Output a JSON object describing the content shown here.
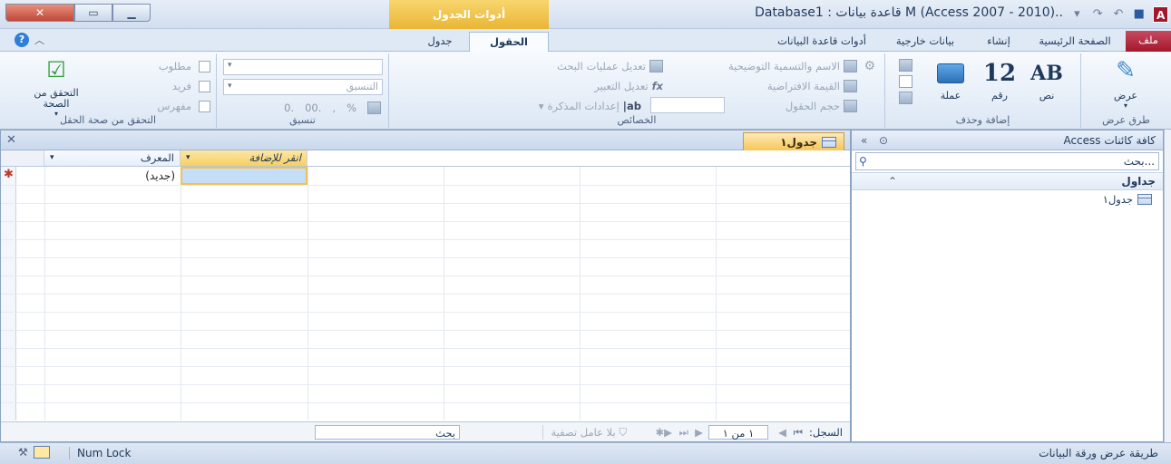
{
  "titlebar": {
    "context_tools": "أدوات الجدول",
    "title": "..M (Access 2007 - 2010) قاعدة بيانات : Database1",
    "app_badge": "A"
  },
  "tabs": {
    "file": "ملف",
    "home": "الصفحة الرئيسية",
    "create": "إنشاء",
    "external": "بيانات خارجية",
    "dbtools": "أدوات قاعدة البيانات",
    "fields": "الحقول",
    "table": "جدول"
  },
  "ribbon": {
    "views": {
      "view": "عرض",
      "group": "طرق عرض"
    },
    "add_delete": {
      "text": "نص",
      "text_glyph": "AB",
      "number": "رقم",
      "number_glyph": "12",
      "currency": "عملة",
      "group": "إضافة وحذف"
    },
    "properties": {
      "name_caption": "الاسم والتسمية التوضيحية",
      "default_value": "القيمة الافتراضية",
      "field_size": "حجم الحقول",
      "modify_lookups": "تعديل عمليات البحث",
      "modify_expression": "تعديل التعبير",
      "memo_settings": "إعدادات المذكرة",
      "group": "الخصائص"
    },
    "formatting": {
      "format_placeholder": "التنسيق",
      "percent": "%",
      "comma": ",",
      "inc": ".00",
      "dec": ".0",
      "group": "تنسيق"
    },
    "validation": {
      "required": "مطلوب",
      "unique": "فريد",
      "indexed": "مفهرس",
      "validation_btn": "التحقق من الصحة",
      "group": "التحقق من صحة الحقل"
    }
  },
  "nav_pane": {
    "header": "كافة كائنات Access",
    "search_placeholder": "...بحث",
    "category": "جداول",
    "items": [
      {
        "label": "جدول١"
      }
    ]
  },
  "document": {
    "tab_label": "جدول١",
    "columns": [
      {
        "label": "المعرف"
      },
      {
        "label": "انقر للإضافة"
      }
    ],
    "new_row_value": "(جديد)"
  },
  "record_nav": {
    "label": "السجل:",
    "position": "١ من ١",
    "no_filter": "بلا عامل تصفية",
    "search": "بحث"
  },
  "statusbar": {
    "view_name": "طريقة عرض ورقة البيانات",
    "num_lock": "Num Lock"
  }
}
